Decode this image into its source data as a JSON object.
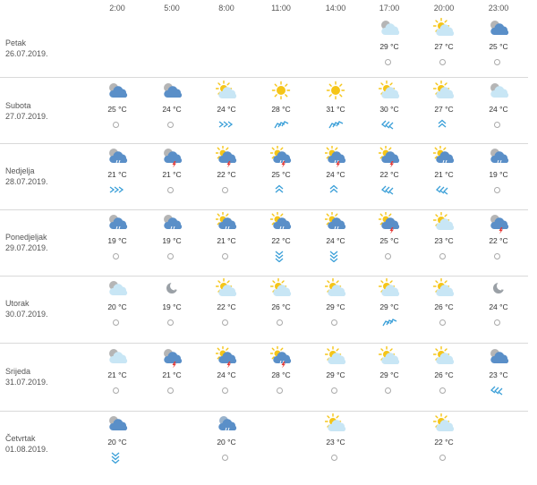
{
  "hours": [
    "2:00",
    "5:00",
    "8:00",
    "11:00",
    "14:00",
    "17:00",
    "20:00",
    "23:00"
  ],
  "days": [
    {
      "name": "Petak",
      "date": "26.07.2019.",
      "cells": [
        null,
        null,
        null,
        null,
        null,
        {
          "icon": "cloud-night-clear",
          "temp": "29 °C"
        },
        {
          "icon": "sun-cloud",
          "temp": "27 °C"
        },
        {
          "icon": "cloud-dark",
          "temp": "25 °C"
        }
      ]
    },
    {
      "name": "Subota",
      "date": "27.07.2019.",
      "cells": [
        {
          "icon": "cloud-dark",
          "temp": "25 °C"
        },
        {
          "icon": "cloud-dark",
          "temp": "24 °C"
        },
        {
          "icon": "sun-cloud",
          "temp": "24 °C",
          "wind": "right"
        },
        {
          "icon": "sun",
          "temp": "28 °C",
          "wind": "up-right"
        },
        {
          "icon": "sun",
          "temp": "31 °C",
          "wind": "up-right"
        },
        {
          "icon": "sun-cloud",
          "temp": "30 °C",
          "wind": "left-down"
        },
        {
          "icon": "sun-cloud",
          "temp": "27 °C",
          "wind": "up"
        },
        {
          "icon": "cloud-light",
          "temp": "24 °C"
        }
      ]
    },
    {
      "name": "Nedjelja",
      "date": "28.07.2019.",
      "cells": [
        {
          "icon": "cloud-rain",
          "temp": "21 °C",
          "wind": "right"
        },
        {
          "icon": "cloud-storm",
          "temp": "21 °C"
        },
        {
          "icon": "sun-storm",
          "temp": "22 °C"
        },
        {
          "icon": "sun-rain-storm",
          "temp": "25 °C",
          "wind": "up"
        },
        {
          "icon": "sun-rain-storm",
          "temp": "24 °C",
          "wind": "up"
        },
        {
          "icon": "sun-storm",
          "temp": "22 °C",
          "wind": "left-down"
        },
        {
          "icon": "sun-rain",
          "temp": "21 °C",
          "wind": "left-down"
        },
        {
          "icon": "cloud-rain",
          "temp": "19 °C"
        }
      ]
    },
    {
      "name": "Ponedjeljak",
      "date": "29.07.2019.",
      "cells": [
        {
          "icon": "cloud-rain",
          "temp": "19 °C"
        },
        {
          "icon": "cloud-rain",
          "temp": "19 °C"
        },
        {
          "icon": "sun-rain",
          "temp": "21 °C"
        },
        {
          "icon": "sun-rain",
          "temp": "22 °C",
          "wind": "down"
        },
        {
          "icon": "sun-rain",
          "temp": "24 °C",
          "wind": "down"
        },
        {
          "icon": "sun-storm",
          "temp": "25 °C"
        },
        {
          "icon": "sun-cloud",
          "temp": "23 °C"
        },
        {
          "icon": "cloud-storm",
          "temp": "22 °C"
        }
      ]
    },
    {
      "name": "Utorak",
      "date": "30.07.2019.",
      "cells": [
        {
          "icon": "cloud-light",
          "temp": "20 °C"
        },
        {
          "icon": "moon",
          "temp": "19 °C"
        },
        {
          "icon": "sun-cloud",
          "temp": "22 °C"
        },
        {
          "icon": "sun-cloud",
          "temp": "26 °C"
        },
        {
          "icon": "sun-cloud",
          "temp": "29 °C"
        },
        {
          "icon": "sun-cloud",
          "temp": "29 °C",
          "wind": "up-right"
        },
        {
          "icon": "sun-cloud",
          "temp": "26 °C"
        },
        {
          "icon": "moon",
          "temp": "24 °C"
        }
      ]
    },
    {
      "name": "Srijeda",
      "date": "31.07.2019.",
      "cells": [
        {
          "icon": "cloud-light",
          "temp": "21 °C"
        },
        {
          "icon": "cloud-storm",
          "temp": "21 °C"
        },
        {
          "icon": "sun-storm",
          "temp": "24 °C"
        },
        {
          "icon": "sun-rain-storm",
          "temp": "28 °C"
        },
        {
          "icon": "sun-cloud",
          "temp": "29 °C"
        },
        {
          "icon": "sun-cloud",
          "temp": "29 °C"
        },
        {
          "icon": "sun-cloud",
          "temp": "26 °C"
        },
        {
          "icon": "cloud-dark",
          "temp": "23 °C",
          "wind": "left-down"
        }
      ]
    },
    {
      "name": "Četvrtak",
      "date": "01.08.2019.",
      "cells": [
        {
          "icon": "cloud-dark",
          "temp": "20 °C",
          "wind": "down"
        },
        null,
        {
          "icon": "cloud-rain-dark",
          "temp": "20 °C"
        },
        null,
        {
          "icon": "sun-cloud",
          "temp": "23 °C"
        },
        null,
        {
          "icon": "sun-cloud",
          "temp": "22 °C"
        },
        null
      ]
    }
  ],
  "colors": {
    "sun": "#f5c518",
    "cloud": "#c8e6f5",
    "cloud_dark": "#5a8fc8",
    "bolt": "#e53935",
    "arrow": "#3a9fd8",
    "line": "#d9d9d9"
  }
}
